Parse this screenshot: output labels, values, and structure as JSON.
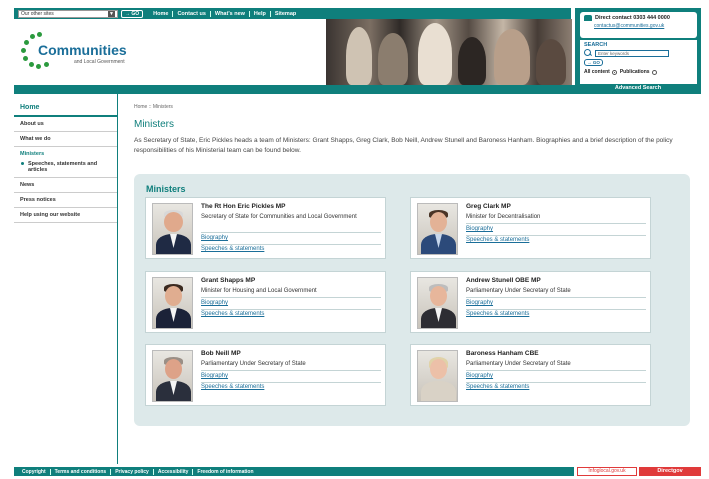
{
  "topbar": {
    "site_select_value": "Our other sites",
    "go_label": "GO",
    "links": [
      "Home",
      "Contact us",
      "What's new",
      "Help",
      "Sitemap"
    ]
  },
  "logo": {
    "name": "Communities",
    "sub": "and Local Government"
  },
  "contact": {
    "title": "Direct contact 0303 444 0000",
    "email": "contactus@communities.gov.uk"
  },
  "search": {
    "label": "SEARCH",
    "placeholder": "Enter keywords",
    "go_label": "GO",
    "scope_all": "All content",
    "scope_publications": "Publications",
    "advanced": "Advanced Search"
  },
  "sidebar": {
    "home": "Home",
    "items": [
      "About us",
      "What we do",
      "Ministers",
      "News",
      "Press notices",
      "Help using our website"
    ],
    "sub_item": "Speeches, statements and articles"
  },
  "main": {
    "breadcrumb": "Home :: Ministers",
    "title": "Ministers",
    "intro": "As Secretary of State, Eric Pickles heads a team of Ministers: Grant Shapps, Greg Clark, Bob Neill, Andrew Stunell and Baroness Hanham. Biographies and a brief description of the policy responsibilities of his Ministerial team can be found below.",
    "box_title": "Ministers"
  },
  "ministers": [
    {
      "name": "The Rt Hon Eric Pickles MP",
      "role": "Secretary of State for Communities and Local Government",
      "bio": "Biography",
      "speeches": "Speeches & statements"
    },
    {
      "name": "Greg Clark MP",
      "role": "Minister for Decentralisation",
      "bio": "Biography",
      "speeches": "Speeches & statements"
    },
    {
      "name": "Grant Shapps MP",
      "role": "Minister for Housing and Local Government",
      "bio": "Biography",
      "speeches": "Speeches & statements"
    },
    {
      "name": "Andrew Stunell OBE MP",
      "role": "Parliamentary Under Secretary of State",
      "bio": "Biography",
      "speeches": "Speeches & statements"
    },
    {
      "name": "Bob Neill MP",
      "role": "Parliamentary Under Secretary of State",
      "bio": "Biography",
      "speeches": "Speeches & statements"
    },
    {
      "name": "Baroness Hanham CBE",
      "role": "Parliamentary Under Secretary of State",
      "bio": "Biography",
      "speeches": "Speeches & statements"
    }
  ],
  "footer": {
    "links": [
      "Copyright",
      "Terms and conditions",
      "Privacy policy",
      "Accessibility",
      "Freedom of information"
    ],
    "info_badge": "Infoglocal.gov.uk",
    "direct_badge": "Directgov"
  },
  "colors": {
    "brand": "#0f7f7c",
    "link": "#1a6e99",
    "box_bg": "#dde9ea",
    "badge_red": "#e03a3a"
  }
}
